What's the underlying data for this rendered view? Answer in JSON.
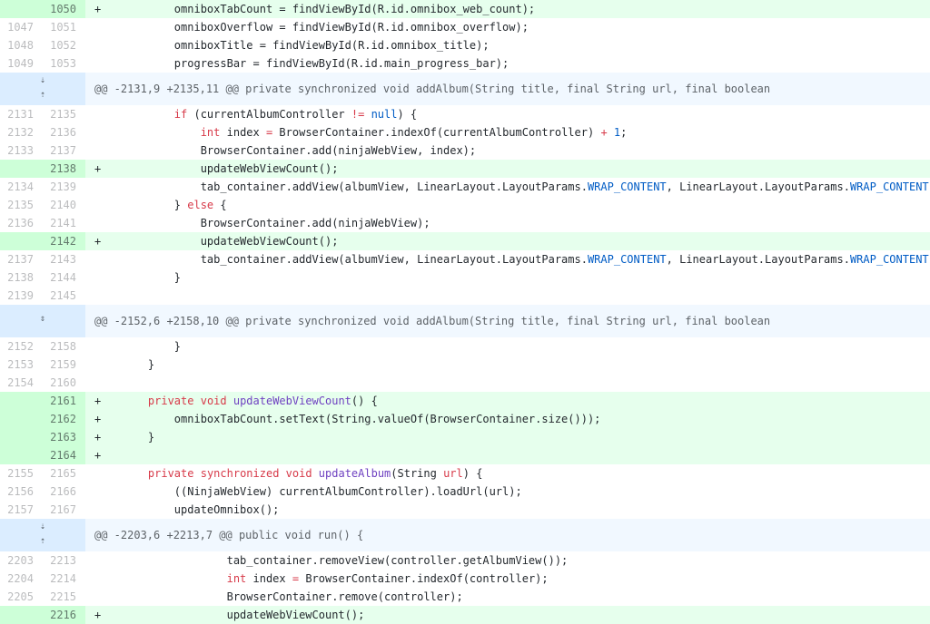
{
  "diff": {
    "rows": [
      {
        "type": "add",
        "old": "",
        "new": "1050",
        "sign": "+",
        "code": [
          {
            "t": "        omniboxTabCount = findViewById(R.id.omnibox_web_count);"
          }
        ]
      },
      {
        "type": "ctx",
        "old": "1047",
        "new": "1051",
        "sign": "",
        "code": [
          {
            "t": "        omniboxOverflow = findViewById(R.id.omnibox_overflow);"
          }
        ]
      },
      {
        "type": "ctx",
        "old": "1048",
        "new": "1052",
        "sign": "",
        "code": [
          {
            "t": "        omniboxTitle = findViewById(R.id.omnibox_title);"
          }
        ]
      },
      {
        "type": "ctx",
        "old": "1049",
        "new": "1053",
        "sign": "",
        "code": [
          {
            "t": "        progressBar = findViewById(R.id.main_progress_bar);"
          }
        ]
      },
      {
        "type": "hunk",
        "expander": "both",
        "code": [
          {
            "t": "@@ -2131,9 +2135,11 @@ private synchronized void addAlbum(String title, final String url, final boolean"
          }
        ]
      },
      {
        "type": "ctx",
        "old": "2131",
        "new": "2135",
        "sign": "",
        "code": [
          {
            "t": "        "
          },
          {
            "t": "if",
            "c": "kw"
          },
          {
            "t": " (currentAlbumController "
          },
          {
            "t": "!=",
            "c": "kw"
          },
          {
            "t": " "
          },
          {
            "t": "null",
            "c": "cst"
          },
          {
            "t": ") {"
          }
        ]
      },
      {
        "type": "ctx",
        "old": "2132",
        "new": "2136",
        "sign": "",
        "code": [
          {
            "t": "            "
          },
          {
            "t": "int",
            "c": "kw"
          },
          {
            "t": " index "
          },
          {
            "t": "=",
            "c": "kw"
          },
          {
            "t": " BrowserContainer.indexOf(currentAlbumController) "
          },
          {
            "t": "+",
            "c": "kw"
          },
          {
            "t": " "
          },
          {
            "t": "1",
            "c": "cst"
          },
          {
            "t": ";"
          }
        ]
      },
      {
        "type": "ctx",
        "old": "2133",
        "new": "2137",
        "sign": "",
        "code": [
          {
            "t": "            BrowserContainer.add(ninjaWebView, index);"
          }
        ]
      },
      {
        "type": "add",
        "old": "",
        "new": "2138",
        "sign": "+",
        "code": [
          {
            "t": "            updateWebViewCount();"
          }
        ]
      },
      {
        "type": "ctx",
        "old": "2134",
        "new": "2139",
        "sign": "",
        "code": [
          {
            "t": "            tab_container.addView(albumView, LinearLayout.LayoutParams."
          },
          {
            "t": "WRAP_CONTENT",
            "c": "cst"
          },
          {
            "t": ", LinearLayout.LayoutParams."
          },
          {
            "t": "WRAP_CONTENT",
            "c": "cst"
          },
          {
            "t": ");"
          }
        ]
      },
      {
        "type": "ctx",
        "old": "2135",
        "new": "2140",
        "sign": "",
        "code": [
          {
            "t": "        } "
          },
          {
            "t": "else",
            "c": "kw"
          },
          {
            "t": " {"
          }
        ]
      },
      {
        "type": "ctx",
        "old": "2136",
        "new": "2141",
        "sign": "",
        "code": [
          {
            "t": "            BrowserContainer.add(ninjaWebView);"
          }
        ]
      },
      {
        "type": "add",
        "old": "",
        "new": "2142",
        "sign": "+",
        "code": [
          {
            "t": "            updateWebViewCount();"
          }
        ]
      },
      {
        "type": "ctx",
        "old": "2137",
        "new": "2143",
        "sign": "",
        "code": [
          {
            "t": "            tab_container.addView(albumView, LinearLayout.LayoutParams."
          },
          {
            "t": "WRAP_CONTENT",
            "c": "cst"
          },
          {
            "t": ", LinearLayout.LayoutParams."
          },
          {
            "t": "WRAP_CONTENT",
            "c": "cst"
          },
          {
            "t": ");"
          }
        ]
      },
      {
        "type": "ctx",
        "old": "2138",
        "new": "2144",
        "sign": "",
        "code": [
          {
            "t": "        }"
          }
        ]
      },
      {
        "type": "ctx",
        "old": "2139",
        "new": "2145",
        "sign": "",
        "code": [
          {
            "t": ""
          }
        ]
      },
      {
        "type": "hunk",
        "expander": "single",
        "code": [
          {
            "t": "@@ -2152,6 +2158,10 @@ private synchronized void addAlbum(String title, final String url, final boolean"
          }
        ]
      },
      {
        "type": "ctx",
        "old": "2152",
        "new": "2158",
        "sign": "",
        "code": [
          {
            "t": "        }"
          }
        ]
      },
      {
        "type": "ctx",
        "old": "2153",
        "new": "2159",
        "sign": "",
        "code": [
          {
            "t": "    }"
          }
        ]
      },
      {
        "type": "ctx",
        "old": "2154",
        "new": "2160",
        "sign": "",
        "code": [
          {
            "t": ""
          }
        ]
      },
      {
        "type": "add",
        "old": "",
        "new": "2161",
        "sign": "+",
        "code": [
          {
            "t": "    "
          },
          {
            "t": "private",
            "c": "kw"
          },
          {
            "t": " "
          },
          {
            "t": "void",
            "c": "kw"
          },
          {
            "t": " "
          },
          {
            "t": "updateWebViewCount",
            "c": "fn"
          },
          {
            "t": "() {"
          }
        ]
      },
      {
        "type": "add",
        "old": "",
        "new": "2162",
        "sign": "+",
        "code": [
          {
            "t": "        omniboxTabCount.setText(String.valueOf(BrowserContainer.size()));"
          }
        ]
      },
      {
        "type": "add",
        "old": "",
        "new": "2163",
        "sign": "+",
        "code": [
          {
            "t": "    }"
          }
        ]
      },
      {
        "type": "add",
        "old": "",
        "new": "2164",
        "sign": "+",
        "code": [
          {
            "t": ""
          }
        ]
      },
      {
        "type": "ctx",
        "old": "2155",
        "new": "2165",
        "sign": "",
        "code": [
          {
            "t": "    "
          },
          {
            "t": "private",
            "c": "kw"
          },
          {
            "t": " "
          },
          {
            "t": "synchronized",
            "c": "kw"
          },
          {
            "t": " "
          },
          {
            "t": "void",
            "c": "kw"
          },
          {
            "t": " "
          },
          {
            "t": "updateAlbum",
            "c": "fn"
          },
          {
            "t": "(String "
          },
          {
            "t": "url",
            "c": "kw"
          },
          {
            "t": ") {"
          }
        ]
      },
      {
        "type": "ctx",
        "old": "2156",
        "new": "2166",
        "sign": "",
        "code": [
          {
            "t": "        ((NinjaWebView) currentAlbumController).loadUrl(url);"
          }
        ]
      },
      {
        "type": "ctx",
        "old": "2157",
        "new": "2167",
        "sign": "",
        "code": [
          {
            "t": "        updateOmnibox();"
          }
        ]
      },
      {
        "type": "hunk",
        "expander": "both",
        "code": [
          {
            "t": "@@ -2203,6 +2213,7 @@ public void run() {"
          }
        ]
      },
      {
        "type": "ctx",
        "old": "2203",
        "new": "2213",
        "sign": "",
        "code": [
          {
            "t": "                tab_container.removeView(controller.getAlbumView());"
          }
        ]
      },
      {
        "type": "ctx",
        "old": "2204",
        "new": "2214",
        "sign": "",
        "code": [
          {
            "t": "                "
          },
          {
            "t": "int",
            "c": "kw"
          },
          {
            "t": " index "
          },
          {
            "t": "=",
            "c": "kw"
          },
          {
            "t": " BrowserContainer.indexOf(controller);"
          }
        ]
      },
      {
        "type": "ctx",
        "old": "2205",
        "new": "2215",
        "sign": "",
        "code": [
          {
            "t": "                BrowserContainer.remove(controller);"
          }
        ]
      },
      {
        "type": "add",
        "old": "",
        "new": "2216",
        "sign": "+",
        "code": [
          {
            "t": "                updateWebViewCount();"
          }
        ]
      }
    ]
  }
}
